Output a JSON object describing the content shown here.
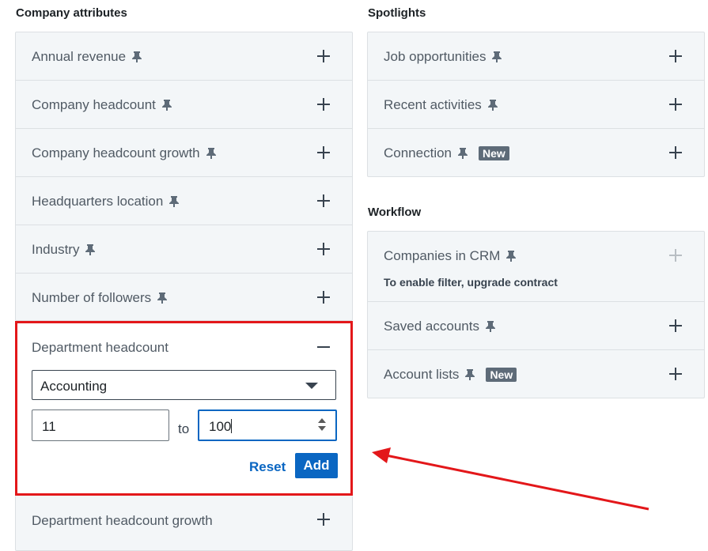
{
  "company_attributes": {
    "title": "Company attributes",
    "items": [
      {
        "label": "Annual revenue"
      },
      {
        "label": "Company headcount"
      },
      {
        "label": "Company headcount growth"
      },
      {
        "label": "Headquarters location"
      },
      {
        "label": "Industry"
      },
      {
        "label": "Number of followers"
      }
    ],
    "expanded": {
      "label": "Department headcount",
      "department_select": "Accounting",
      "min_value": "11",
      "to_label": "to",
      "max_value": "100",
      "reset_label": "Reset",
      "add_label": "Add"
    },
    "after_items": [
      {
        "label": "Department headcount growth"
      }
    ]
  },
  "spotlights": {
    "title": "Spotlights",
    "items": [
      {
        "label": "Job opportunities",
        "badge": ""
      },
      {
        "label": "Recent activities",
        "badge": ""
      },
      {
        "label": "Connection",
        "badge": "New"
      }
    ]
  },
  "workflow": {
    "title": "Workflow",
    "items": [
      {
        "label": "Companies in CRM",
        "note": "To enable filter, upgrade contract",
        "disabled": true
      },
      {
        "label": "Saved accounts",
        "badge": ""
      },
      {
        "label": "Account lists",
        "badge": "New"
      }
    ]
  },
  "colors": {
    "accent": "#0a66c2",
    "highlight": "#e3171a",
    "panel_bg": "#f3f6f8",
    "badge_bg": "#5e6b78"
  }
}
